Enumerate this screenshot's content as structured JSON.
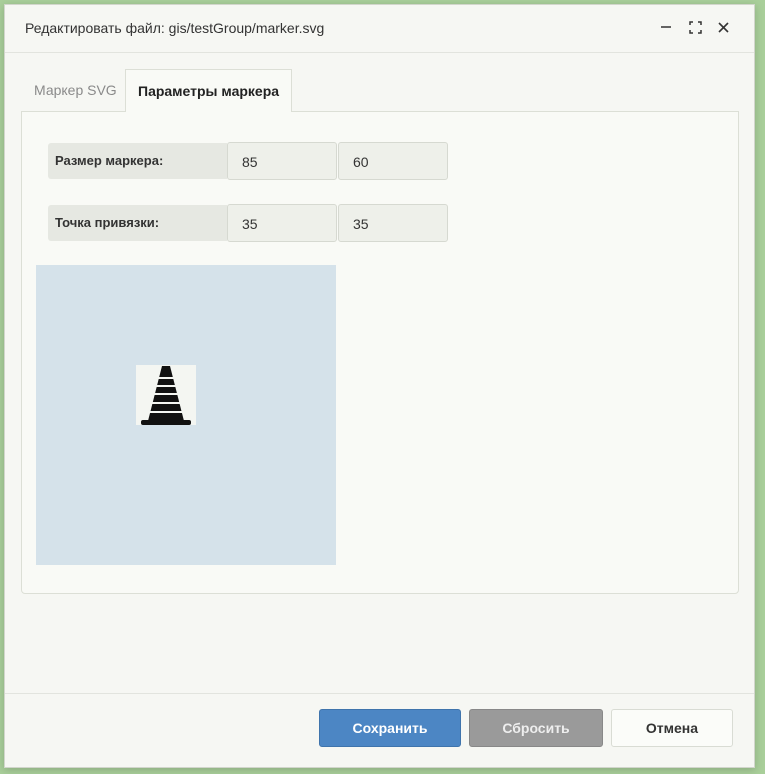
{
  "window": {
    "title": "Редактировать файл: gis/testGroup/marker.svg",
    "controls": [
      "minimize-icon",
      "maximize-icon",
      "close-icon"
    ]
  },
  "tabs": [
    {
      "label": "Маркер SVG",
      "active": false
    },
    {
      "label": "Параметры маркера",
      "active": true
    }
  ],
  "params": {
    "size": {
      "label": "Размер маркера:",
      "width": "85",
      "height": "60"
    },
    "anchor": {
      "label": "Точка привязки:",
      "x": "35",
      "y": "35"
    }
  },
  "preview": {
    "icon": "traffic-cone-icon",
    "background": "#d5e2ea"
  },
  "buttons": {
    "save": "Сохранить",
    "reset": "Сбросить",
    "cancel": "Отмена"
  },
  "colors": {
    "accent": "#4c86c4",
    "disabled": "#9a9a9a",
    "background": "#a9cf9a"
  }
}
